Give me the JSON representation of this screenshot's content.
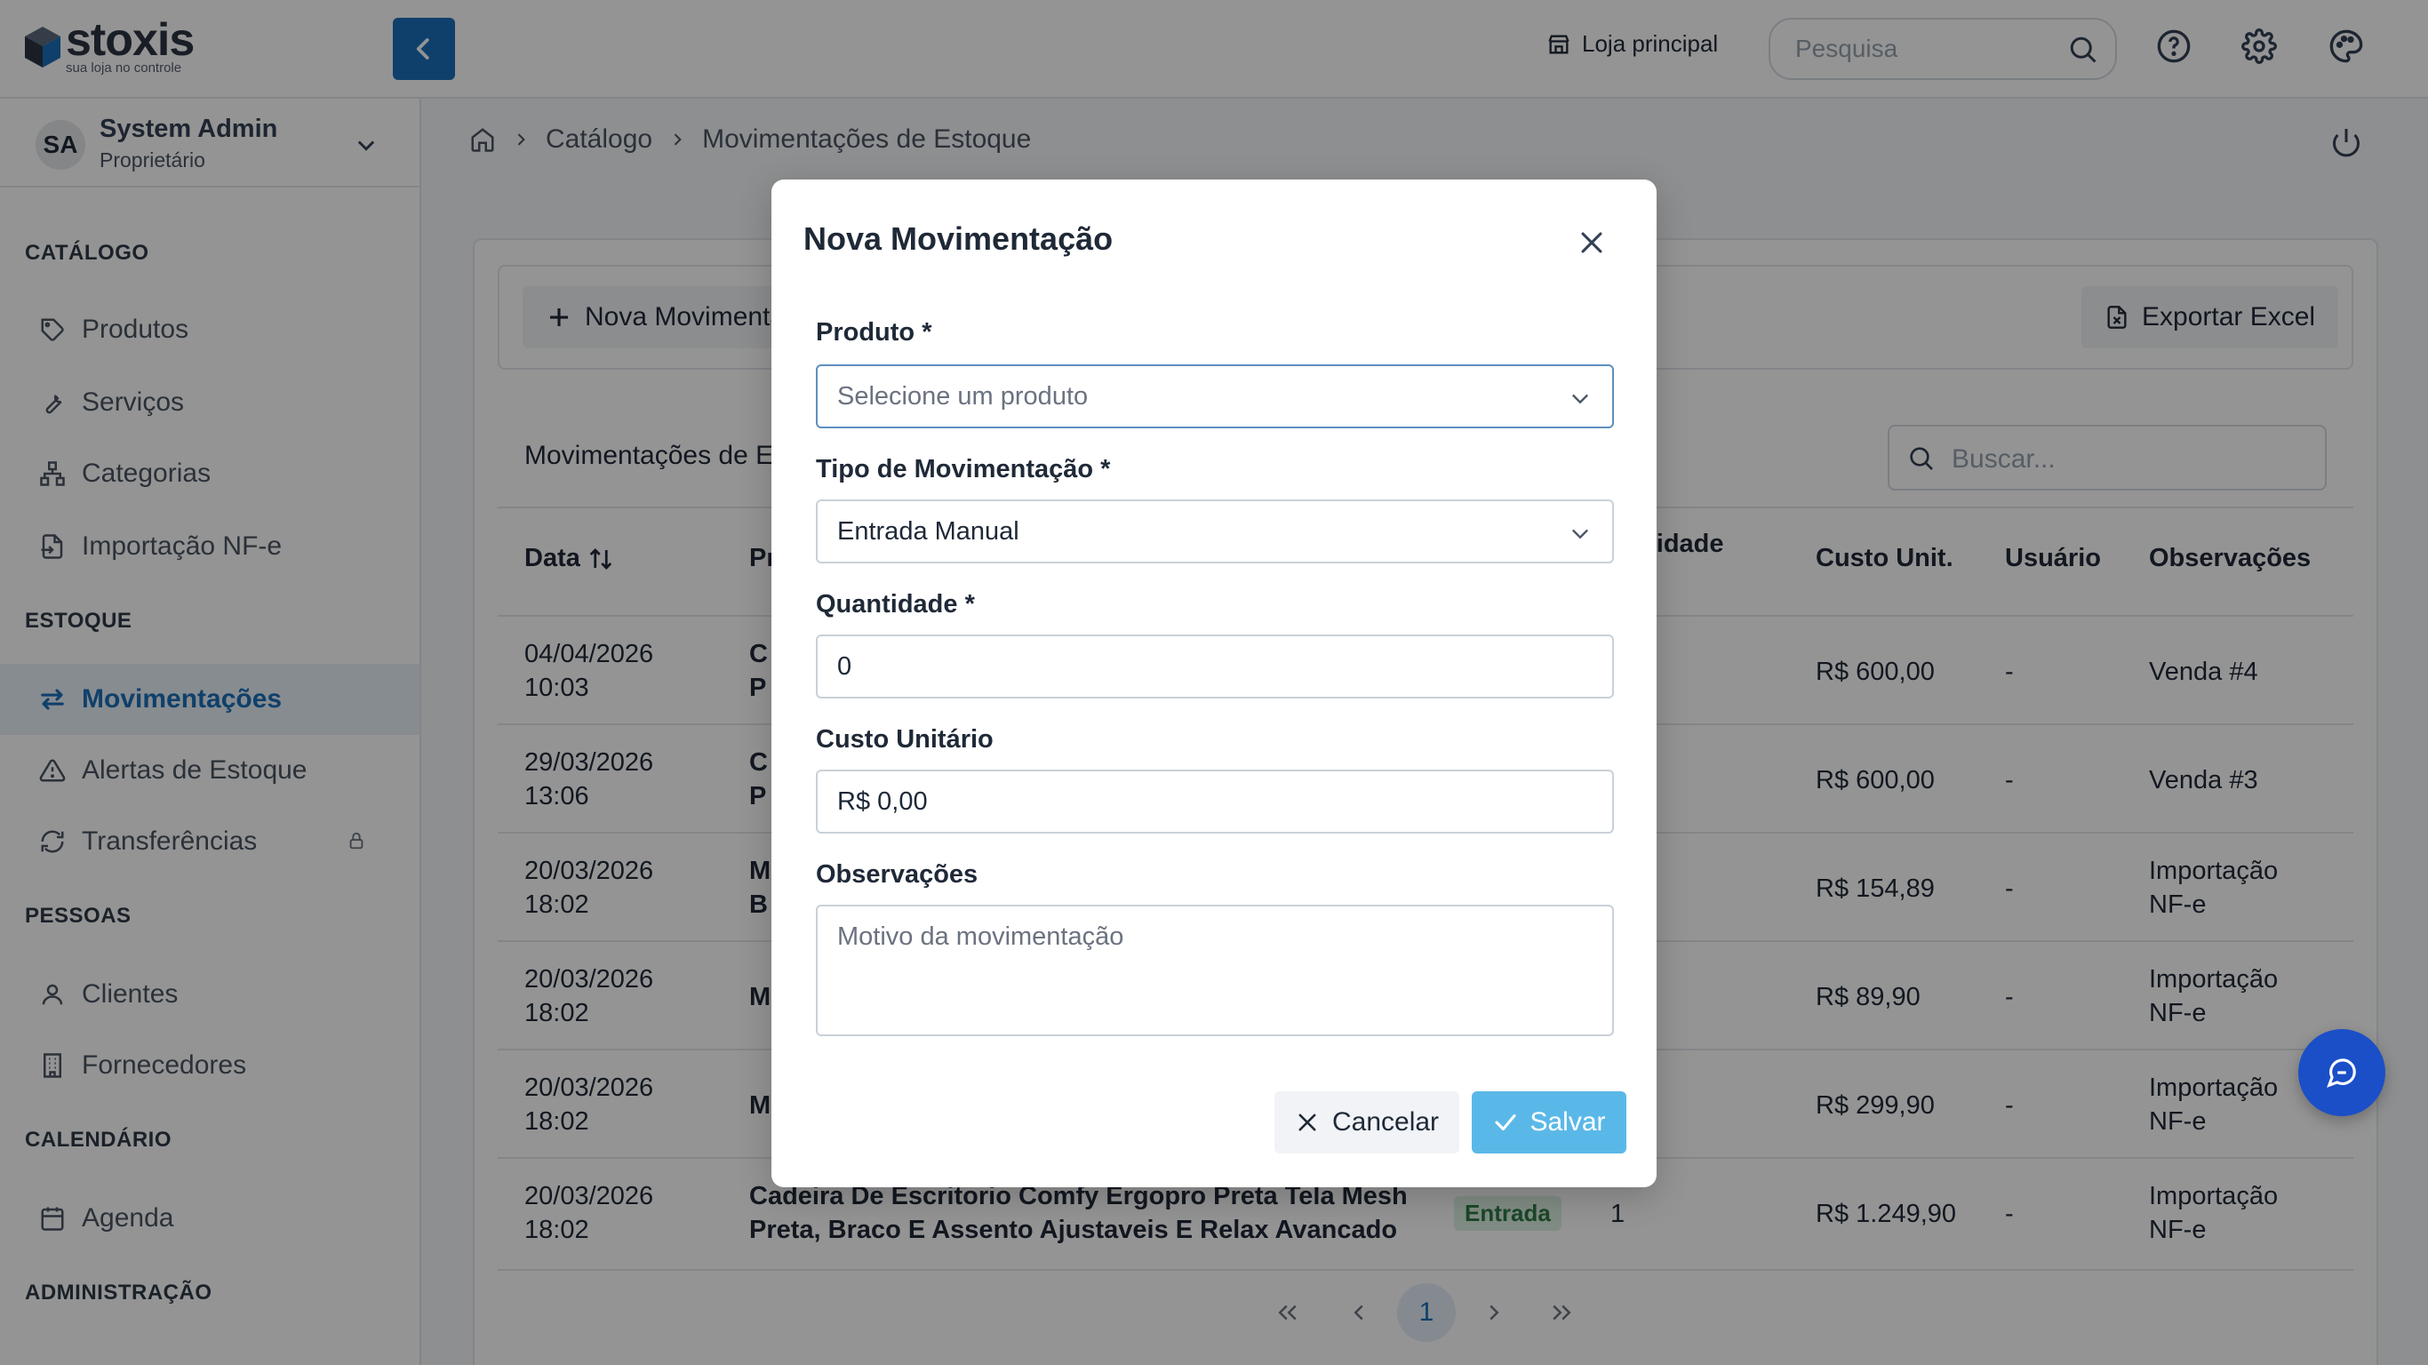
{
  "app": {
    "name": "stoxis",
    "tagline": "sua loja no controle",
    "store_label": "Loja principal",
    "search_placeholder": "Pesquisa"
  },
  "user": {
    "initials": "SA",
    "name": "System Admin",
    "role": "Proprietário"
  },
  "sidebar": {
    "sections": [
      {
        "title": "CATÁLOGO",
        "items": [
          {
            "label": "Produtos",
            "icon": "tag-icon"
          },
          {
            "label": "Serviços",
            "icon": "wrench-icon"
          },
          {
            "label": "Categorias",
            "icon": "hierarchy-icon"
          },
          {
            "label": "Importação NF-e",
            "icon": "file-import-icon"
          }
        ]
      },
      {
        "title": "ESTOQUE",
        "items": [
          {
            "label": "Movimentações",
            "icon": "arrows-exchange-icon",
            "active": true
          },
          {
            "label": "Alertas de Estoque",
            "icon": "warning-icon"
          },
          {
            "label": "Transferências",
            "icon": "refresh-icon",
            "locked": true
          }
        ]
      },
      {
        "title": "PESSOAS",
        "items": [
          {
            "label": "Clientes",
            "icon": "user-icon"
          },
          {
            "label": "Fornecedores",
            "icon": "building-icon"
          }
        ]
      },
      {
        "title": "CALENDÁRIO",
        "items": [
          {
            "label": "Agenda",
            "icon": "calendar-icon"
          }
        ]
      },
      {
        "title": "ADMINISTRAÇÃO",
        "items": []
      }
    ]
  },
  "breadcrumb": [
    "Catálogo",
    "Movimentações de Estoque"
  ],
  "toolbar": {
    "new_label": "Nova Movimentação",
    "export_label": "Exportar Excel"
  },
  "table": {
    "title": "Movimentações de Estoque",
    "search_placeholder": "Buscar...",
    "headers": {
      "date": "Data",
      "product": "Produto",
      "qty": "Quantidade",
      "unit_cost": "Custo Unit.",
      "user": "Usuário",
      "notes": "Observações"
    },
    "rows": [
      {
        "date": "04/04/2026",
        "time": "10:03",
        "product_1": "C",
        "product_2": "P",
        "type": "",
        "qty": "",
        "unit_cost": "R$ 600,00",
        "user": "-",
        "notes_1": "Venda #4",
        "notes_2": ""
      },
      {
        "date": "29/03/2026",
        "time": "13:06",
        "product_1": "C",
        "product_2": "P",
        "type": "",
        "qty": "",
        "unit_cost": "R$ 600,00",
        "user": "-",
        "notes_1": "Venda #3",
        "notes_2": ""
      },
      {
        "date": "20/03/2026",
        "time": "18:02",
        "product_1": "M",
        "product_2": "B",
        "type": "",
        "qty": "",
        "unit_cost": "R$ 154,89",
        "user": "-",
        "notes_1": "Importação",
        "notes_2": "NF-e"
      },
      {
        "date": "20/03/2026",
        "time": "18:02",
        "product_1": "M",
        "product_2": "",
        "type": "",
        "qty": "",
        "unit_cost": "R$ 89,90",
        "user": "-",
        "notes_1": "Importação",
        "notes_2": "NF-e"
      },
      {
        "date": "20/03/2026",
        "time": "18:02",
        "product_1": "M",
        "product_2": "",
        "type": "",
        "qty": "",
        "unit_cost": "R$ 299,90",
        "user": "-",
        "notes_1": "Importação",
        "notes_2": "NF-e"
      },
      {
        "date": "20/03/2026",
        "time": "18:02",
        "product_1": "Cadeira De Escritorio Comfy Ergopro Preta Tela Mesh",
        "product_2": "Preta, Braco E Assento Ajustaveis E Relax Avancado",
        "type": "Entrada",
        "qty": "1",
        "unit_cost": "R$ 1.249,90",
        "user": "-",
        "notes_1": "Importação",
        "notes_2": "NF-e"
      }
    ]
  },
  "pagination": {
    "current": "1"
  },
  "modal": {
    "title": "Nova Movimentação",
    "product_label": "Produto *",
    "product_placeholder": "Selecione um produto",
    "type_label": "Tipo de Movimentação *",
    "type_value": "Entrada Manual",
    "qty_label": "Quantidade *",
    "qty_value": "0",
    "cost_label": "Custo Unitário",
    "cost_value": "R$ 0,00",
    "notes_label": "Observações",
    "notes_placeholder": "Motivo da movimentação",
    "cancel_label": "Cancelar",
    "save_label": "Salvar"
  },
  "colors": {
    "primary": "#1a6fb8",
    "save_button": "#5ab8e8",
    "badge_bg": "#dcf2e3",
    "badge_text": "#2f7a45",
    "fab": "#1a4fc7"
  }
}
